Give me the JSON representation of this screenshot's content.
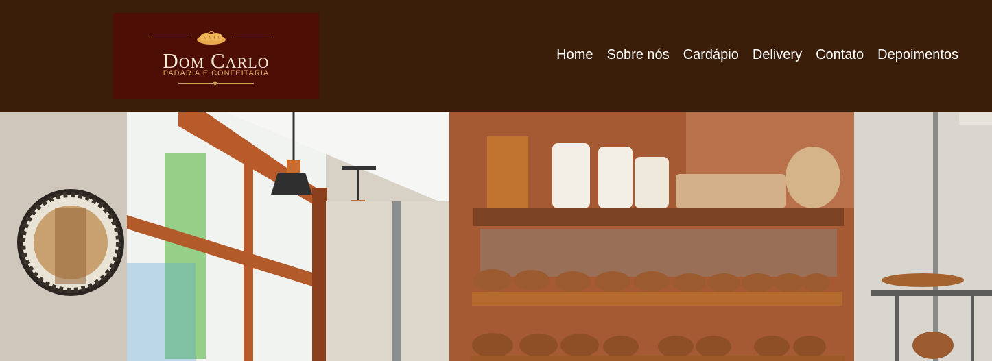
{
  "logo": {
    "name": "Dom Carlo",
    "tagline": "PADARIA E CONFEITARIA"
  },
  "nav": {
    "items": [
      "Home",
      "Sobre nós",
      "Cardápio",
      "Delivery",
      "Contato",
      "Depoimentos"
    ]
  },
  "hero": {
    "image": "bakery-interior-photo"
  },
  "colors": {
    "header_bg": "#3b1e0a",
    "logo_bg": "#4d0e05",
    "logo_gold": "#c9a15b",
    "nav_text": "#ffffff"
  }
}
